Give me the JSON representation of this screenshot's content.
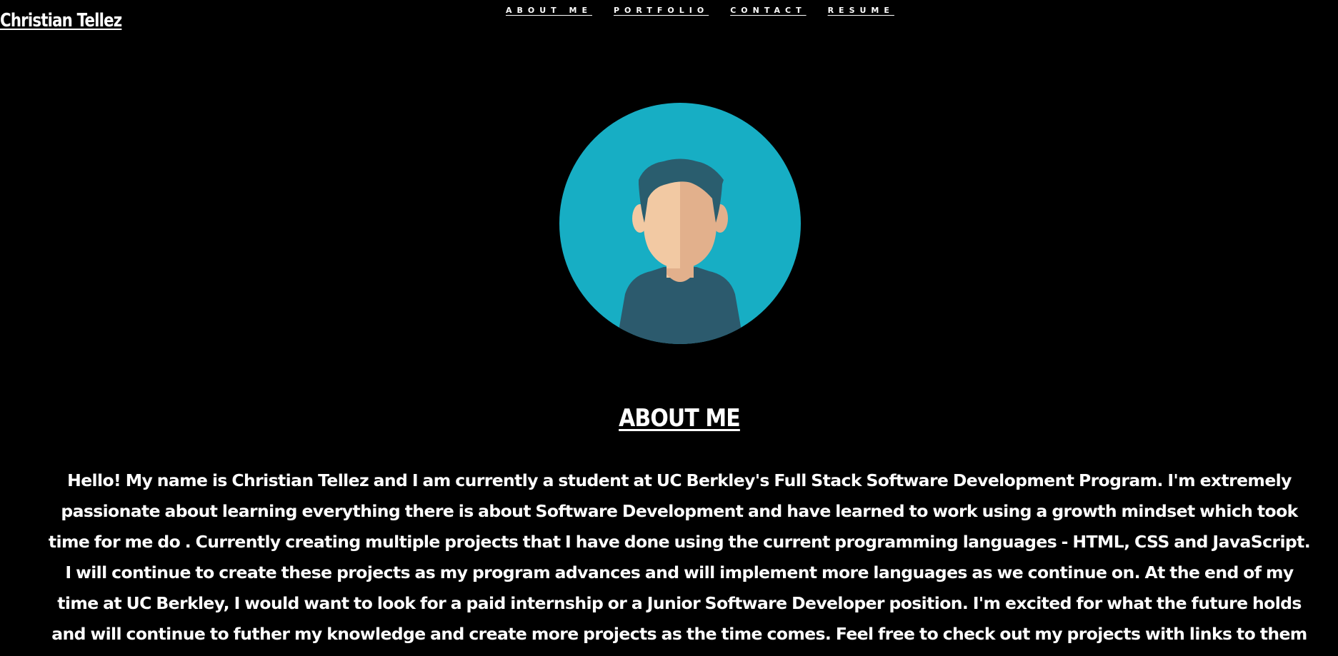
{
  "brand": {
    "name": "Christian Tellez"
  },
  "nav": {
    "items": [
      {
        "label": "ABOUT ME"
      },
      {
        "label": "PORTFOLIO"
      },
      {
        "label": "CONTACT"
      },
      {
        "label": "RESUME"
      }
    ]
  },
  "avatar": {
    "icon": "person-avatar-icon",
    "colors": {
      "circle": "#17aec4",
      "hair": "#2a5d6e",
      "skin_light": "#f2c9a3",
      "skin_shade": "#e2b08c",
      "shirt": "#2c5a6d"
    }
  },
  "about": {
    "heading": "ABOUT ME",
    "body": "Hello! My name is Christian Tellez and I am currently a student at UC Berkley's Full Stack Software Development Program. I'm extremely passionate about learning everything there is about Software Development and have learned to work using a growth mindset which took time for me do . Currently creating multiple projects that I have done using the current programming languages - HTML, CSS and JavaScript. I will continue to create these projects as my program advances and will implement more languages as we continue on. At the end of my time at UC Berkley, I would want to look for a paid internship or a Junior Software Developer position. I'm excited for what the future holds and will continue to futher my knowledge and create more projects as the time comes. Feel free to check out my projects with links to them down below and if you'd like to contact me , my information to my Github and LinkedIn at the bottom of the page!"
  },
  "theme": {
    "background": "#000000",
    "text": "#ffffff"
  }
}
